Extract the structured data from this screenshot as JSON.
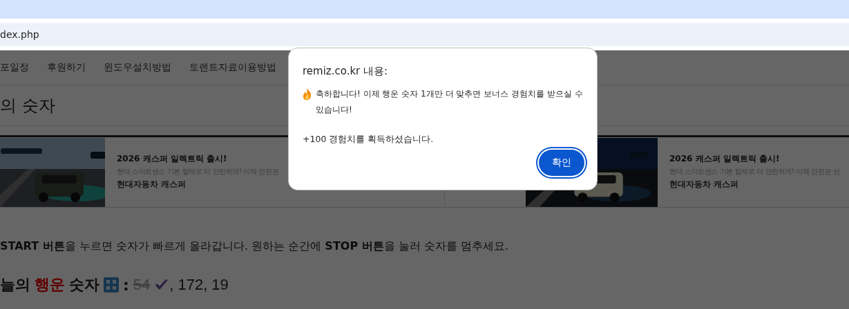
{
  "address_bar": {
    "url": "dex.php"
  },
  "nav": {
    "items": [
      {
        "label": "포일정"
      },
      {
        "label": "후원하기"
      },
      {
        "label": "윈도우설치방법"
      },
      {
        "label": "토렌트자료이용방법"
      }
    ]
  },
  "page_title": "의 숫자",
  "ads": [
    {
      "title": "2026 캐스퍼 일렉트릭 출시!",
      "description": "현대 스마트센스 기본 탑재로 더 안전하게! 이제 안전은",
      "brand": "현대자동차 캐스퍼"
    },
    {
      "title": "2026 캐스퍼 일렉트릭 출시!",
      "description": "현대 스마트센스 기본 탑재로 더 안전하게! 이제 안전은 선",
      "brand": "현대자동차 캐스퍼"
    }
  ],
  "instructions": "**START 버튼**을 누르면 숫자가 빠르게 올라갑니다. 원하는 순간에 **STOP 버튼**을 눌러 숫자를 멈추세요.",
  "lucky": {
    "prefix": "늘의",
    "highlight": "행운",
    "suffix": "숫자",
    "colon": ":",
    "separator": ", ",
    "numbers": [
      {
        "value": "54",
        "matched": true
      },
      {
        "value": "172",
        "matched": false
      },
      {
        "value": "19",
        "matched": false
      }
    ]
  },
  "dialog": {
    "title": "remiz.co.kr 내용:",
    "message": "축하합니다! 이제 행운 숫자 1개만 더 맞추면 보너스 경험치를 받으실 수 있습니다!",
    "reward": "+100 경험치를 획득하셨습니다.",
    "button": "확인"
  }
}
